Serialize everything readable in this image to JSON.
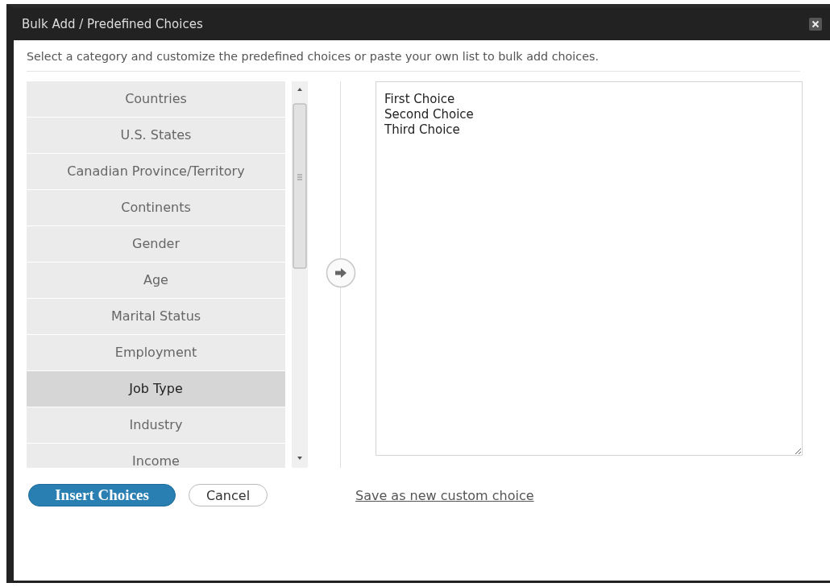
{
  "window": {
    "title": "Bulk Add / Predefined Choices"
  },
  "instructions": "Select a category and customize the predefined choices or paste your own list to bulk add choices.",
  "categories": [
    {
      "label": "Countries",
      "selected": false
    },
    {
      "label": "U.S. States",
      "selected": false
    },
    {
      "label": "Canadian Province/Territory",
      "selected": false
    },
    {
      "label": "Continents",
      "selected": false
    },
    {
      "label": "Gender",
      "selected": false
    },
    {
      "label": "Age",
      "selected": false
    },
    {
      "label": "Marital Status",
      "selected": false
    },
    {
      "label": "Employment",
      "selected": false
    },
    {
      "label": "Job Type",
      "selected": true
    },
    {
      "label": "Industry",
      "selected": false
    },
    {
      "label": "Income",
      "selected": false
    }
  ],
  "choices_field": {
    "value": "First Choice\nSecond Choice\nThird Choice"
  },
  "buttons": [
    {
      "label": "Insert Choices",
      "kind": "primary"
    },
    {
      "label": "Cancel",
      "kind": "secondary"
    }
  ],
  "link": "Save as new custom choice"
}
